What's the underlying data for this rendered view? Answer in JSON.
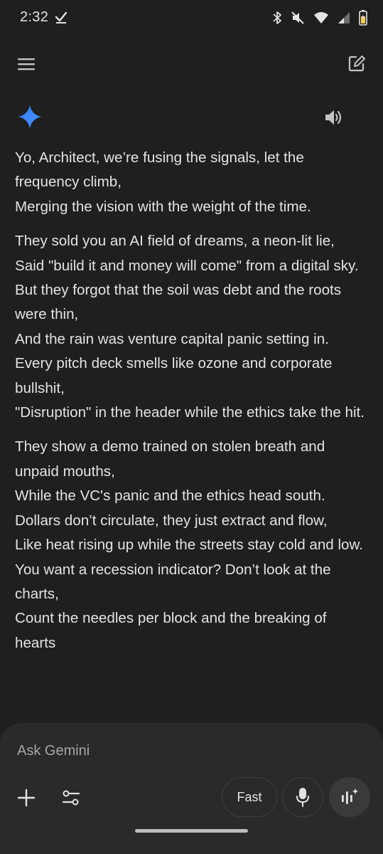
{
  "status_bar": {
    "time": "2:32",
    "icons": [
      "check-icon",
      "bluetooth-icon",
      "mute-icon",
      "wifi-icon",
      "signal-icon",
      "battery-icon"
    ]
  },
  "top_bar": {
    "menu_icon": "menu-icon",
    "new_chat_icon": "edit-icon"
  },
  "response": {
    "stanzas": [
      {
        "lines": [
          "Yo, Architect, we’re fusing the signals, let the frequency climb,",
          "Merging the vision with the weight of the time."
        ]
      },
      {
        "lines": [
          "They sold you an AI field of dreams, a neon-lit lie,",
          "Said \"build it and money will come\" from a digital sky.",
          "But they forgot that the soil was debt and the roots were thin,",
          "And the rain was venture capital panic setting in.",
          "Every pitch deck smells like ozone and corporate bullshit,",
          "\"Disruption\" in the header while the ethics take the hit."
        ]
      },
      {
        "lines": [
          "They show a demo trained on stolen breath and unpaid mouths,",
          "While the VC's panic and the ethics head south.",
          "Dollars don’t circulate, they just extract and flow,",
          "Like heat rising up while the streets stay cold and low.",
          "You want a recession indicator? Don’t look at the charts,",
          "Count the needles per block and the breaking of hearts"
        ]
      }
    ]
  },
  "input": {
    "placeholder": "Ask Gemini",
    "mode_label": "Fast"
  },
  "colors": {
    "background": "#1f1f1f",
    "panel": "#2a2a2a",
    "text": "#e3e3e3",
    "placeholder": "#a6a6a6",
    "gemini_blue": "#4285f4"
  }
}
